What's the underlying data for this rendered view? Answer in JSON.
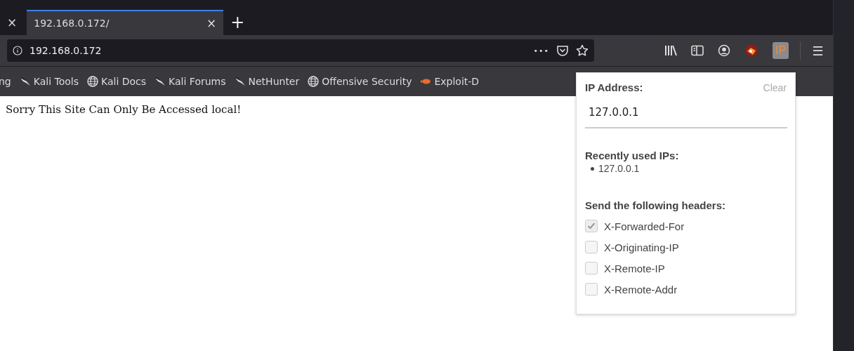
{
  "tabs": [
    {
      "close": "×",
      "selected": false
    },
    {
      "label": "192.168.0.172/",
      "close": "×",
      "selected": true
    }
  ],
  "new_tab": "+",
  "url_bar": {
    "value": "192.168.0.172",
    "more": "•••"
  },
  "ip_button": {
    "label": "IP",
    "selected": true
  },
  "menu": "☰",
  "bookmarks": [
    {
      "label": "ng",
      "kind": "plain"
    },
    {
      "label": "Kali Tools",
      "kind": "kali"
    },
    {
      "label": "Kali Docs",
      "kind": "globe"
    },
    {
      "label": "Kali Forums",
      "kind": "kali"
    },
    {
      "label": "NetHunter",
      "kind": "kali"
    },
    {
      "label": "Offensive Security",
      "kind": "globe"
    },
    {
      "label": "Exploit-D",
      "kind": "exploit"
    }
  ],
  "page": {
    "message": "Sorry This Site Can Only Be Accessed local!"
  },
  "popup": {
    "title": "IP Address:",
    "clear": "Clear",
    "ip_value": "127.0.0.1",
    "recent_title": "Recently used IPs:",
    "recent": [
      "127.0.0.1"
    ],
    "headers_title": "Send the following headers:",
    "headers": [
      {
        "label": "X-Forwarded-For",
        "checked": true
      },
      {
        "label": "X-Originating-IP",
        "checked": false
      },
      {
        "label": "X-Remote-IP",
        "checked": false
      },
      {
        "label": "X-Remote-Addr",
        "checked": false
      }
    ]
  }
}
